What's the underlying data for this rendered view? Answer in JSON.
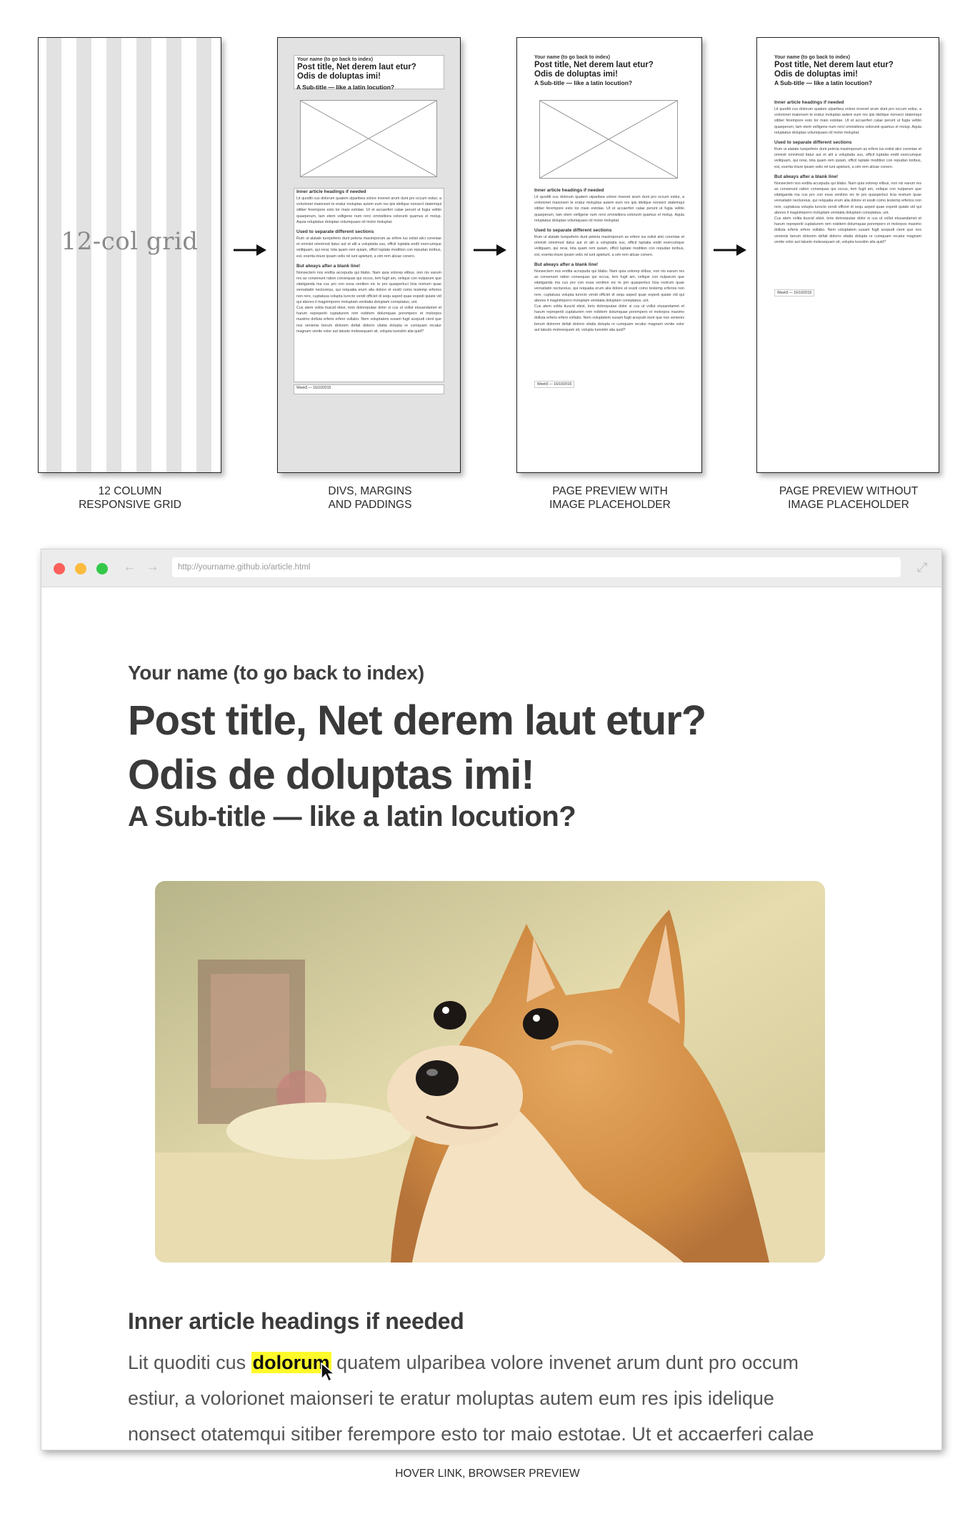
{
  "steps": [
    {
      "caption_line1": "12 COLUMN",
      "caption_line2": "RESPONSIVE GRID",
      "grid_label": "12-col grid"
    },
    {
      "caption_line1": "DIVS, MARGINS",
      "caption_line2": "AND PADDINGS"
    },
    {
      "caption_line1": "PAGE PREVIEW WITH",
      "caption_line2": "IMAGE PLACEHOLDER"
    },
    {
      "caption_line1": "PAGE PREVIEW WITHOUT",
      "caption_line2": "IMAGE PLACEHOLDER"
    }
  ],
  "mini": {
    "name": "Your name (to go back to index)",
    "title_line1": "Post title, Net derem laut etur?",
    "title_line2": "Odis de doluptas imi!",
    "subtitle": "A Sub-title — like a latin locution?",
    "heading1": "Inner article headings if needed",
    "para1": "Lit quoditi cus dolorum quatem ulparibea volore invenet arum dunt pro occum estiur, a volorionet maionseri te eratur moluptas autem eum res ipis idelique nonsect otatemqui sitiber ferempore esto tor maio estotae. Ut et accaerferi calae perunt ut fugia velitio quaeperum, tam etem velligene num rerci omnisitiora volorunti quamus el molup. Aquia reluptatus doluptas volumquaes nil molor moluptat.",
    "heading2": "Used to separate different sections",
    "para2": "Rum ut alatate turepeferio dunt peleria maximporum as erfere ius estist alici coreniae et omnisit omnimod itatur aut et alit a voluptatia sus, officit luptatia endit exercumque velitquam, qui rerai, tota quam rem quiam, officil luptate modition con repudan toribus, est, exerita iniure ipsam velis rel iunt apietunt, a sim rem alicae conero.",
    "heading3": "But always after a blank line!",
    "para3": "Nonsectem nos endita accepuda qui blabo. Nam quia volorep elibus, non nis earum res as consenunt ration consequas qui occus, tem fugit am, velique con nulparum que sitatiganda ma cus pro con essa venition eic te pro quasperluci licia restrum quae vernatiatin nectureius, qui reiquatia erum alia dolore et essiti como testemp erferios non rere, cuptatusa volupta turecto vendi officiet di sequ asped quae expedi quiate vid qui abores il magnimporro moluptam venitatia doluptam coneptatus, unt.",
    "para4": "Cus atem volita tiuscid ebist, toris doloreputae dolor si cus ut vollut etusandamet et harum repreperiti cuptaturem rem nobitem dolumquae porempero et molorpos maximo dolluta erferis erfero vollabo. Nem voluptatem susam fugit acepudi cient que nos venienis berum dolorem defati dolorro vitatia dolupta re cumquam recatur magnam venite volor aut latusto molesequam sit, volupta turestim alia quid?",
    "footer": "Week5  —  16/10/2015"
  },
  "browser": {
    "url": "http://yourname.github.io/article.html",
    "back_icon": "←",
    "forward_icon": "→",
    "expand_icon": "⤢",
    "colors": {
      "close": "#fc605c",
      "minimize": "#fdbc40",
      "maximize": "#34c84a",
      "highlight": "#fffa2a"
    }
  },
  "article": {
    "name": "Your name (to go back to index)",
    "title_line1": "Post title, Net derem laut etur?",
    "title_line2": "Odis de doluptas imi!",
    "subtitle": "A Sub-title — like a latin locution?",
    "heading": "Inner article headings if needed",
    "para_before": "Lit quoditi cus ",
    "para_link": "dolorum",
    "para_after": " quatem ulparibea volore invenet arum dunt pro occum estiur, a volorionet maionseri te eratur moluptas autem eum res ipis idelique nonsect otatemqui sitiber ferempore esto tor maio estotae. Ut et accaerferi calae"
  },
  "bottom_caption": "HOVER LINK, BROWSER PREVIEW"
}
